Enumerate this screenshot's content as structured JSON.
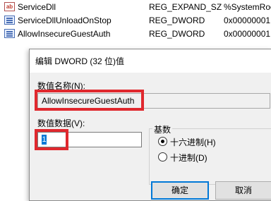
{
  "registry_rows": [
    {
      "icon": "string-value-icon",
      "name": "ServiceDll",
      "type": "REG_EXPAND_SZ",
      "data": "%SystemRoo"
    },
    {
      "icon": "binary-value-icon",
      "name": "ServiceDllUnloadOnStop",
      "type": "REG_DWORD",
      "data": "0x00000001"
    },
    {
      "icon": "binary-value-icon",
      "name": "AllowInsecureGuestAuth",
      "type": "REG_DWORD",
      "data": "0x00000001"
    }
  ],
  "dialog": {
    "title": "编辑 DWORD (32 位)值",
    "name_label": "数值名称(N):",
    "name_value": "AllowInsecureGuestAuth",
    "data_label": "数值数据(V):",
    "data_value": "1",
    "base_label": "基数",
    "base_options": [
      {
        "label": "十六进制(H)",
        "selected": true
      },
      {
        "label": "十进制(D)",
        "selected": false
      }
    ],
    "ok_label": "确定",
    "cancel_label": "取消"
  },
  "colors": {
    "highlight_red": "#e0282e",
    "selection_blue": "#0078d7"
  }
}
